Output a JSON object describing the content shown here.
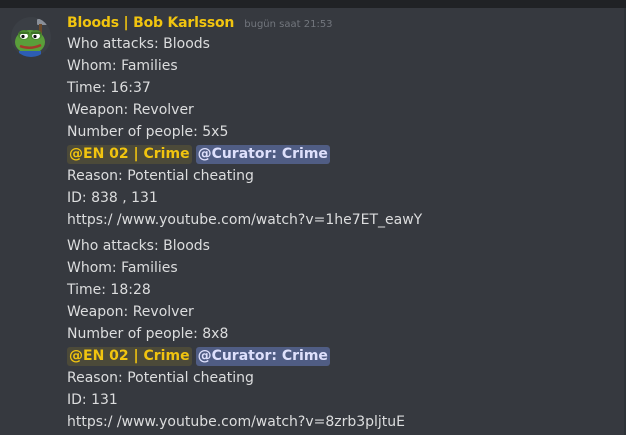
{
  "message": {
    "author": "Bloods | Bob Karlsson",
    "timestamp": "bugün saat 21:53",
    "author_color": "#f1c40f",
    "avatar_icon": "pepe-frog-icon"
  },
  "reports": [
    {
      "attacker": "Who attacks: Bloods",
      "target": "Whom: Families",
      "time": "Time: 16:37",
      "weapon": "Weapon: Revolver",
      "people": "Number of people: 5x5",
      "role_mention": "@EN 02 | Crime",
      "curator_mention": "@Curator: Crime",
      "reason": "Reason: Potential cheating",
      "id": "ID: 838 , 131",
      "link": "https:/ /www.youtube.com/watch?v=1he7ET_eawY"
    },
    {
      "attacker": "Who attacks: Bloods",
      "target": "Whom: Families",
      "time": "Time: 18:28",
      "weapon": "Weapon: Revolver",
      "people": "Number of people: 8x8",
      "role_mention": "@EN 02 | Crime",
      "curator_mention": "@Curator: Crime",
      "reason": "Reason: Potential cheating",
      "id": "ID: 131",
      "link": "https:/ /www.youtube.com/watch?v=8zrb3pljtuE"
    }
  ]
}
